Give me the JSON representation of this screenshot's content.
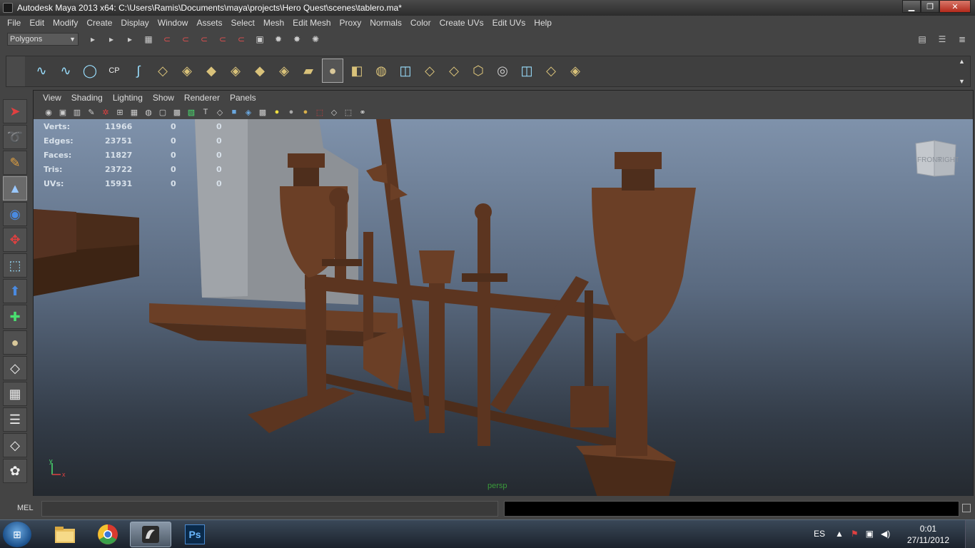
{
  "window": {
    "title": "Autodesk Maya 2013 x64: C:\\Users\\Ramis\\Documents\\maya\\projects\\Hero Quest\\scenes\\tablero.ma*",
    "minimize": "▁",
    "maximize": "❐",
    "close": "✕"
  },
  "menubar": [
    "File",
    "Edit",
    "Modify",
    "Create",
    "Display",
    "Window",
    "Assets",
    "Select",
    "Mesh",
    "Edit Mesh",
    "Proxy",
    "Normals",
    "Color",
    "Create UVs",
    "Edit UVs",
    "Help"
  ],
  "statusline": {
    "menuset": "Polygons",
    "icons": [
      "new-scene-icon",
      "open-scene-icon",
      "save-scene-icon",
      "select-hierarchy-icon",
      "select-object-icon",
      "select-component-icon",
      "snap-grid-icon",
      "snap-curve-icon",
      "snap-point-icon",
      "snap-plane-icon",
      "make-live-icon",
      "render-icon",
      "ipr-icon",
      "render-settings-icon",
      "hypershade-icon"
    ]
  },
  "shelf": {
    "tools": [
      "ep-curve-tool",
      "pencil-curve-tool",
      "circle-tool",
      "cv-curve-tool",
      "bezier-tool",
      "polygon-plane-tool",
      "extrude-tool",
      "bevel-tool",
      "bridge-tool",
      "append-tool",
      "split-tool",
      "smooth-tool",
      "material-sphere-tool",
      "cube-tool",
      "sphere-tool",
      "uv-editor-tool",
      "planar-map-tool",
      "cylindrical-map-tool",
      "automatic-map-tool",
      "unfold-tool",
      "layout-uv-tool",
      "snapshot-tool",
      "texture-editor-tool"
    ],
    "selected_index": 12
  },
  "panel": {
    "menu": [
      "View",
      "Shading",
      "Lighting",
      "Show",
      "Renderer",
      "Panels"
    ],
    "camera": "persp"
  },
  "hud": {
    "rows": [
      {
        "label": "Verts:",
        "v1": "11966",
        "v2": "0",
        "v3": "0"
      },
      {
        "label": "Edges:",
        "v1": "23751",
        "v2": "0",
        "v3": "0"
      },
      {
        "label": "Faces:",
        "v1": "11827",
        "v2": "0",
        "v3": "0"
      },
      {
        "label": "Tris:",
        "v1": "23722",
        "v2": "0",
        "v3": "0"
      },
      {
        "label": "UVs:",
        "v1": "15931",
        "v2": "0",
        "v3": "0"
      }
    ]
  },
  "viewcube": {
    "front": "FRONT",
    "right": "RIGHT"
  },
  "axis": {
    "y": "y",
    "x": "x"
  },
  "cmdline": {
    "label": "MEL"
  },
  "taskbar": {
    "apps": [
      "explorer",
      "chrome",
      "maya",
      "photoshop"
    ],
    "active_app": "maya",
    "photoshop_label": "Ps",
    "language": "ES",
    "time": "0:01",
    "date": "27/11/2012"
  },
  "colors": {
    "wood": "#5c3520",
    "wood_light": "#7a4a2e",
    "viewport_top": "#7f92ab",
    "viewport_bottom": "#24292f"
  }
}
